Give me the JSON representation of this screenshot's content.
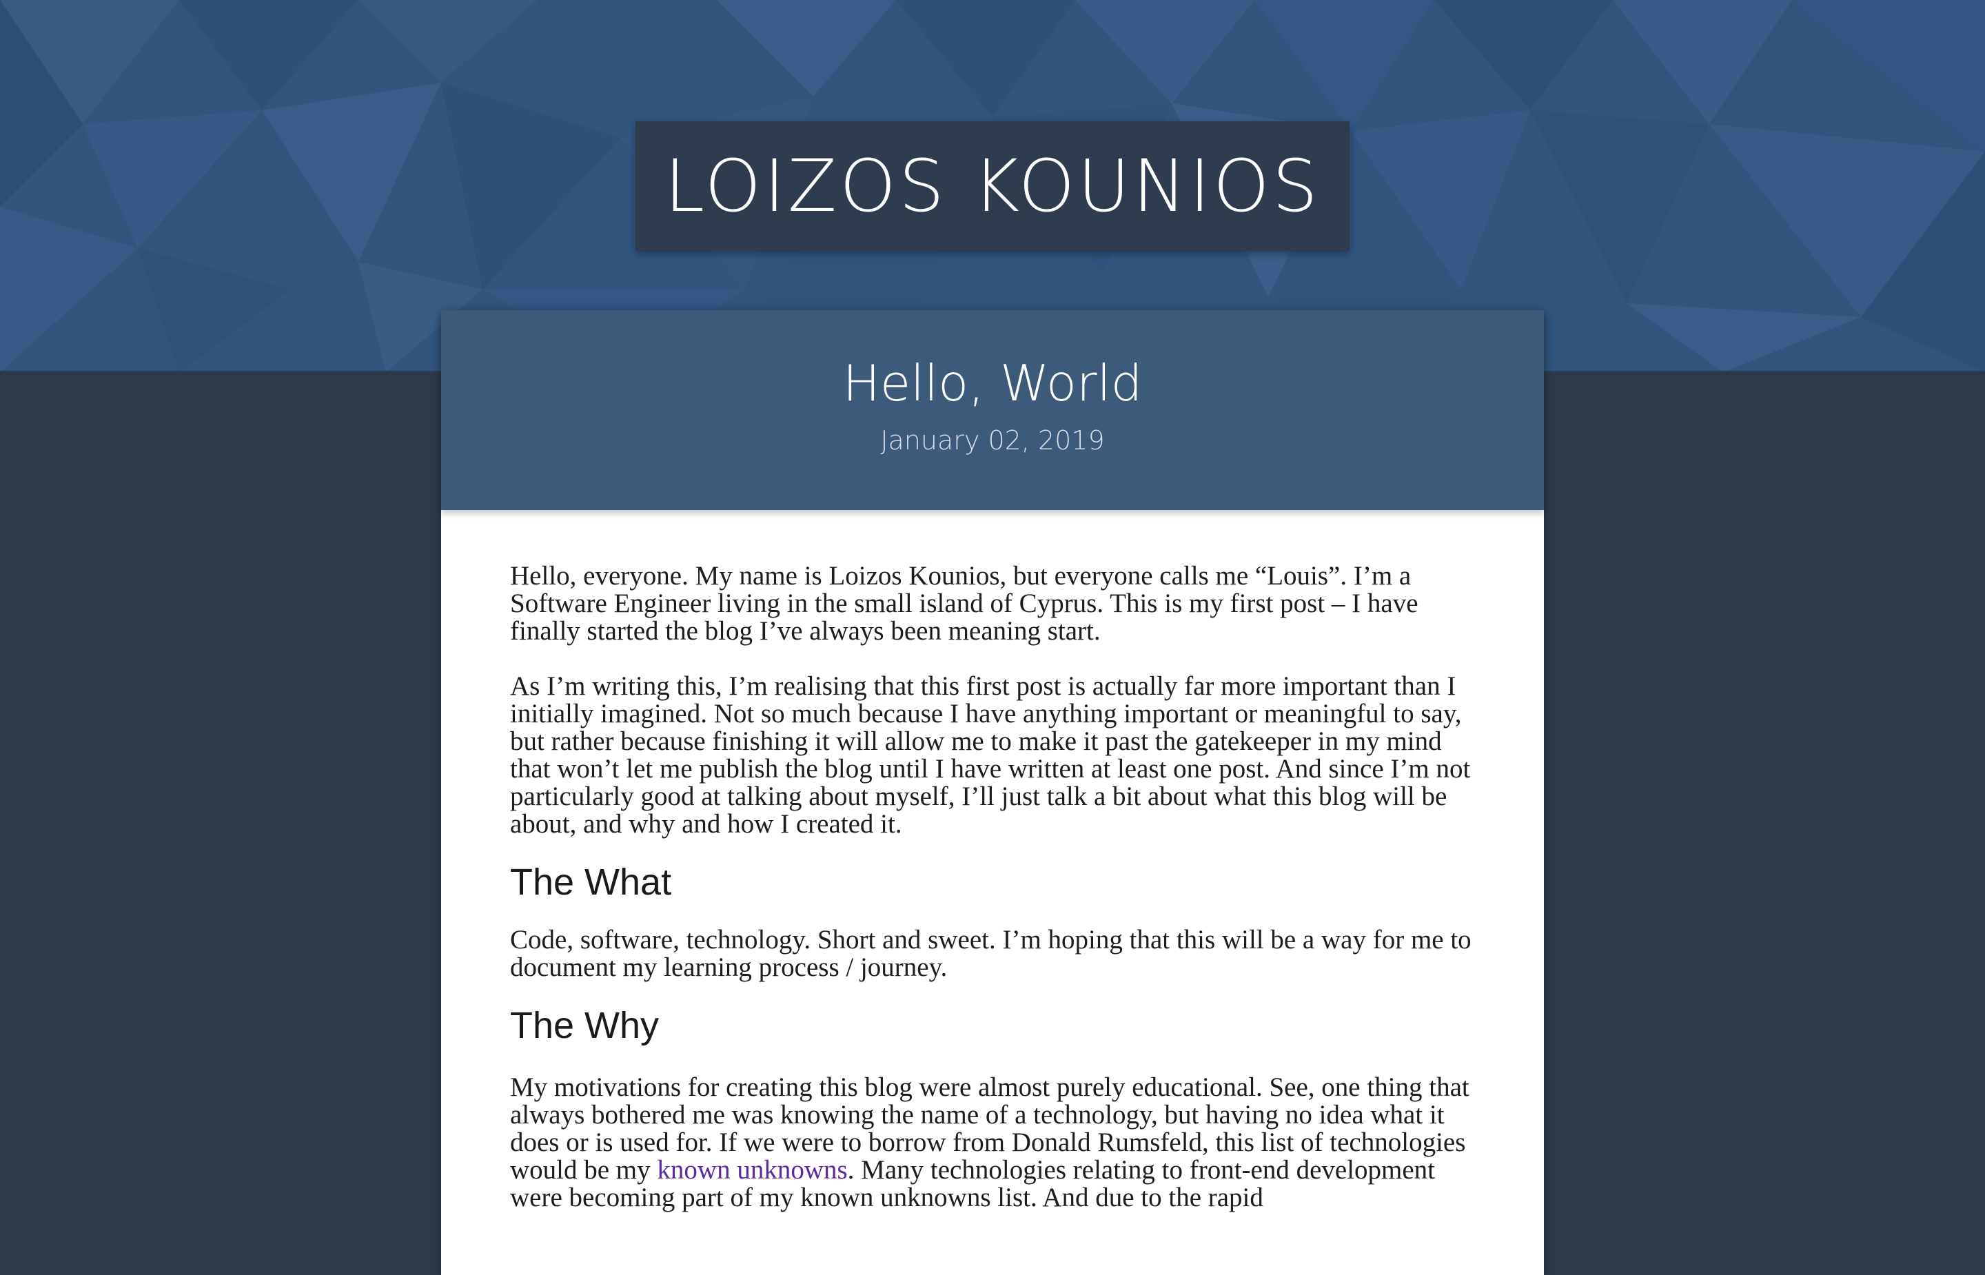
{
  "site": {
    "title": "LOIZOS KOUNIOS"
  },
  "post": {
    "title": "Hello, World",
    "date": "January 02, 2019",
    "paragraph_1": "Hello, everyone. My name is Loizos Kounios, but everyone calls me “Louis”. I’m a Software Engineer living in the small island of Cyprus. This is my first post – I have finally started the blog I’ve always been meaning start.",
    "paragraph_2": "As I’m writing this, I’m realising that this first post is actually far more important than I initially imagined. Not so much because I have anything important or meaningful to say, but rather because finishing it will allow me to make it past the gatekeeper in my mind that won’t let me publish the blog until I have written at least one post. And since I’m not particularly good at talking about myself, I’ll just talk a bit about what this blog will be about, and why and how I created it.",
    "heading_what": "The What",
    "paragraph_3": "Code, software, technology. Short and sweet. I’m hoping that this will be a way for me to document my learning process / journey.",
    "heading_why": "The Why",
    "paragraph_4_before_link": "My motivations for creating this blog were almost purely educational. See, one thing that always bothered me was knowing the name of a technology, but having no idea what it does or is used for. If we were to borrow from Donald Rumsfeld, this list of technologies would be my ",
    "paragraph_4_link": "known unknowns",
    "paragraph_4_after_link": ". Many technologies relating to front-end development were becoming part of my known unknowns list. And due to the rapid"
  },
  "colors": {
    "hero_background": "#32557e",
    "page_background": "#2e3a48",
    "title_box": "#2f3c4d",
    "post_header": "#3e5a7a",
    "link": "#5a2aa0"
  }
}
